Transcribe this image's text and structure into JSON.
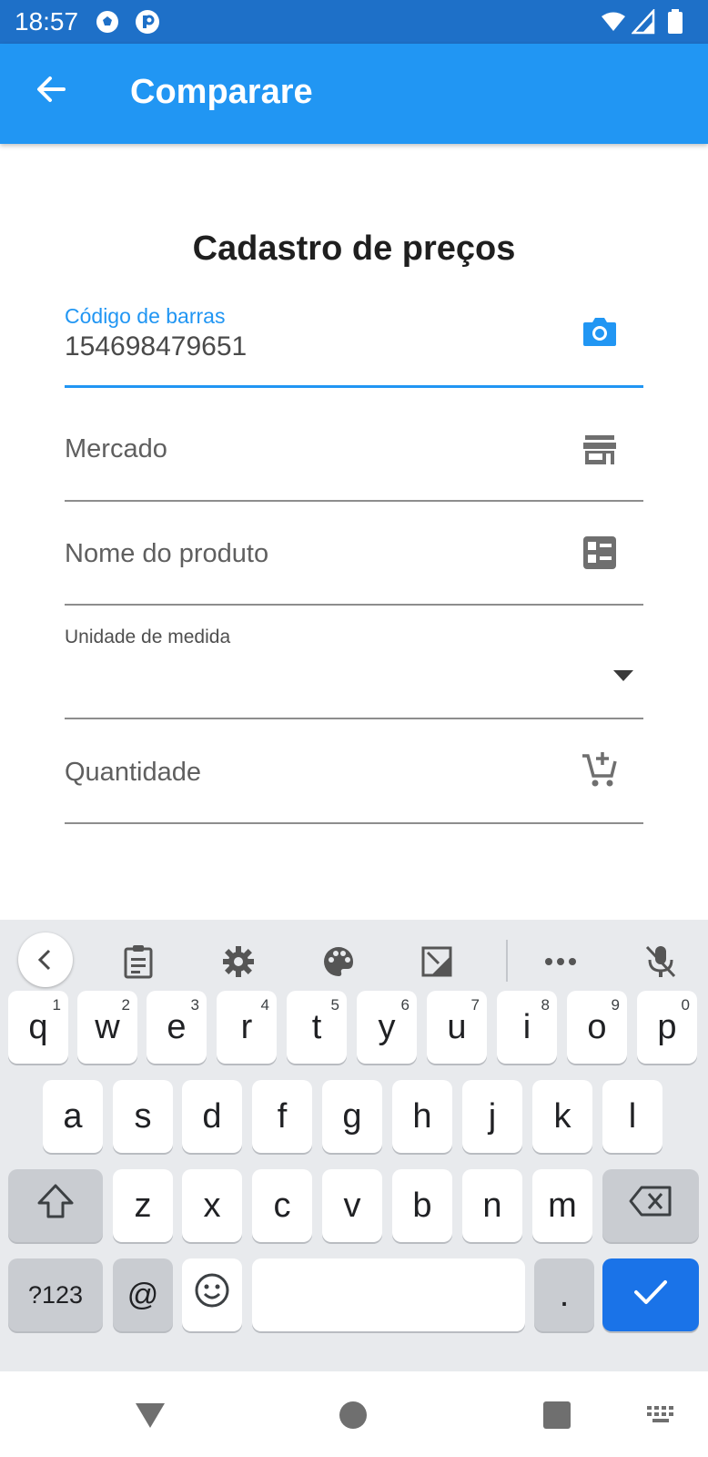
{
  "status_bar": {
    "time": "18:57",
    "icons": [
      "soccer-ball-icon",
      "app-p-icon",
      "wifi-icon",
      "signal-icon",
      "battery-icon"
    ]
  },
  "app_bar": {
    "title": "Comparare",
    "back_icon": "arrow-back-icon",
    "color": "#2196f3"
  },
  "form": {
    "title": "Cadastro de preços",
    "barcode": {
      "label": "Código de barras",
      "value": "154698479651",
      "icon": "camera-icon"
    },
    "market": {
      "placeholder": "Mercado",
      "icon": "store-icon"
    },
    "product_name": {
      "placeholder": "Nome do produto",
      "icon": "list-card-icon"
    },
    "unit": {
      "label": "Unidade de medida",
      "value": "",
      "icon": "dropdown-arrow-icon"
    },
    "quantity": {
      "placeholder": "Quantidade",
      "icon": "add-shopping-cart-icon"
    }
  },
  "keyboard": {
    "toolbar": [
      "chevron-left-icon",
      "clipboard-icon",
      "settings-icon",
      "palette-icon",
      "one-handed-mode-icon",
      "more-icon",
      "mic-off-icon"
    ],
    "row1": [
      {
        "key": "q",
        "hint": "1"
      },
      {
        "key": "w",
        "hint": "2"
      },
      {
        "key": "e",
        "hint": "3"
      },
      {
        "key": "r",
        "hint": "4"
      },
      {
        "key": "t",
        "hint": "5"
      },
      {
        "key": "y",
        "hint": "6"
      },
      {
        "key": "u",
        "hint": "7"
      },
      {
        "key": "i",
        "hint": "8"
      },
      {
        "key": "o",
        "hint": "9"
      },
      {
        "key": "p",
        "hint": "0"
      }
    ],
    "row2": [
      "a",
      "s",
      "d",
      "f",
      "g",
      "h",
      "j",
      "k",
      "l"
    ],
    "row3": [
      "z",
      "x",
      "c",
      "v",
      "b",
      "n",
      "m"
    ],
    "symbols_key": "?123",
    "at_key": "@",
    "period_key": ".",
    "enter_color": "#1a73e8"
  },
  "nav_bar": {
    "icons": [
      "back-triangle-icon",
      "home-circle-icon",
      "recents-square-icon",
      "keyboard-switch-icon"
    ]
  }
}
